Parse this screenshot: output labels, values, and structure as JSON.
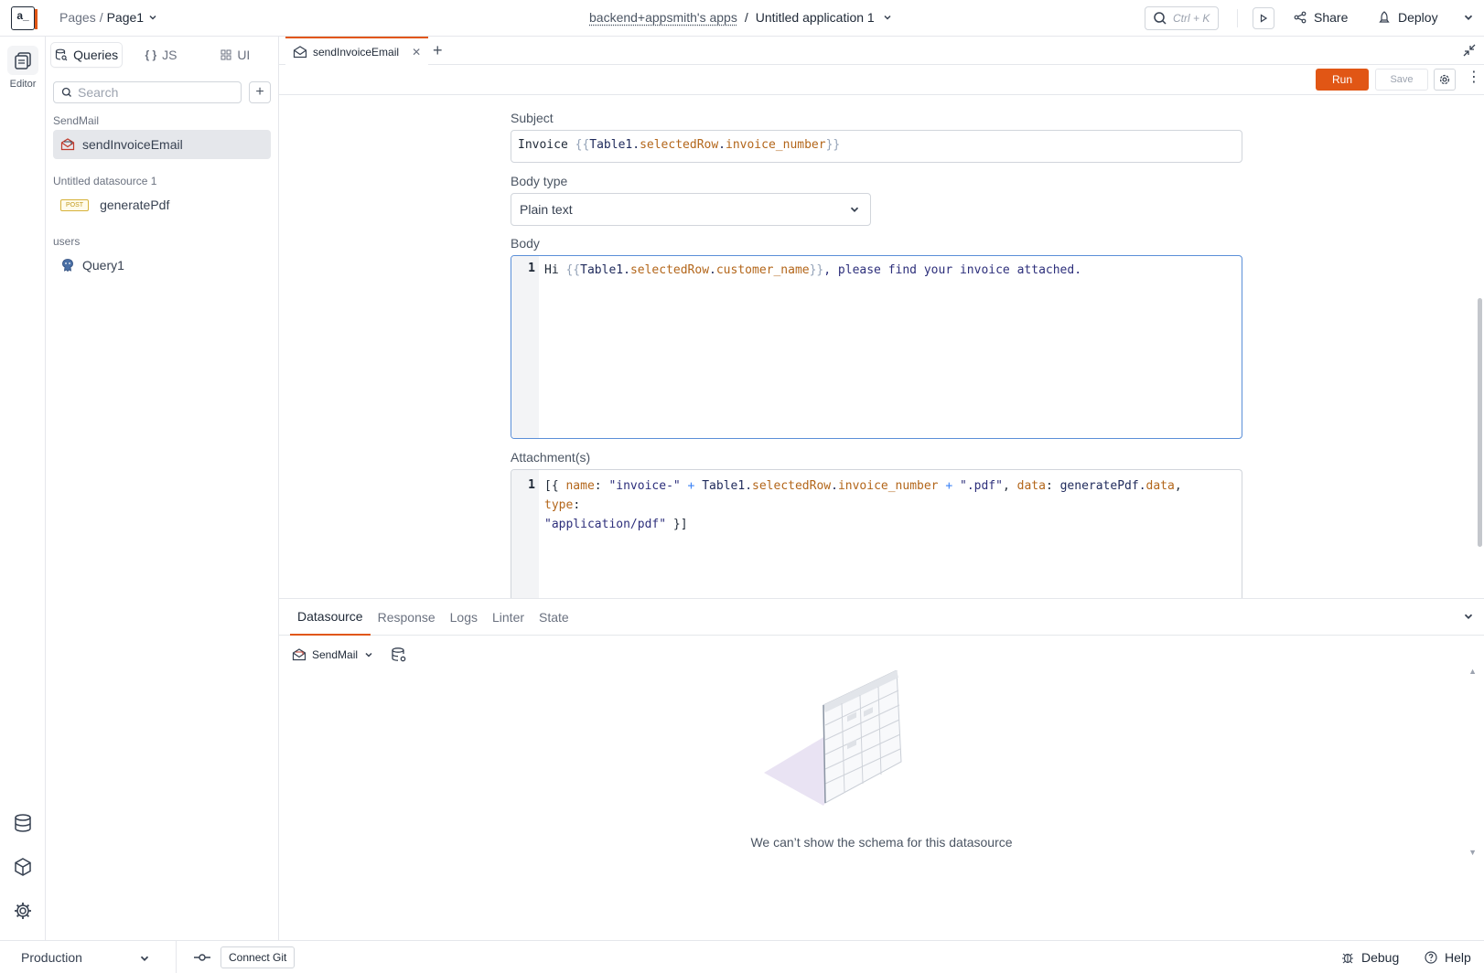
{
  "header": {
    "logo_text": "a_",
    "breadcrumb_root": "Pages",
    "breadcrumb_sep": "/",
    "page_name": "Page1",
    "workspace": "backend+appsmith's apps",
    "app_sep": "/",
    "app_name": "Untitled application 1",
    "search_shortcut": "Ctrl + K",
    "share_label": "Share",
    "deploy_label": "Deploy"
  },
  "rail": {
    "editor_label": "Editor",
    "icons": [
      "pages-icon",
      "datasource-icon",
      "packages-icon",
      "settings-icon"
    ]
  },
  "sidebar": {
    "tabs": [
      {
        "label": "Queries",
        "icon": "queries-icon",
        "active": true
      },
      {
        "label": "JS",
        "icon": "js-icon",
        "active": false
      },
      {
        "label": "UI",
        "icon": "ui-icon",
        "active": false
      }
    ],
    "search_placeholder": "Search",
    "groups": [
      {
        "name": "SendMail",
        "items": [
          {
            "label": "sendInvoiceEmail",
            "icon": "mail-icon",
            "active": true
          }
        ]
      },
      {
        "name": "Untitled datasource 1",
        "items": [
          {
            "label": "generatePdf",
            "badge": "POST",
            "active": false
          }
        ]
      },
      {
        "name": "users",
        "items": [
          {
            "label": "Query1",
            "icon": "postgres-icon",
            "active": false
          }
        ]
      }
    ]
  },
  "editor": {
    "tab_label": "sendInvoiceEmail",
    "run_label": "Run",
    "save_label": "Save",
    "subject": {
      "label": "Subject",
      "value_parts": [
        "Invoice ",
        "{{",
        "Table1",
        ".",
        "selectedRow",
        ".",
        "invoice_number",
        "}}"
      ]
    },
    "body_type": {
      "label": "Body type",
      "value": "Plain text"
    },
    "body": {
      "label": "Body",
      "line_no": "1",
      "parts": [
        "Hi ",
        "{{",
        "Table1",
        ".",
        "selectedRow",
        ".",
        "customer_name",
        "}}",
        ", please find your invoice attached."
      ]
    },
    "attachments": {
      "label": "Attachment(s)",
      "line_no": "1",
      "parts": [
        "[{ ",
        "name",
        ": ",
        "\"invoice-\"",
        " + ",
        "Table1",
        ".",
        "selectedRow",
        ".",
        "invoice_number",
        " + ",
        "\".pdf\"",
        ", ",
        "data",
        ": ",
        "generatePdf",
        ".",
        "data",
        ", ",
        "type",
        ":",
        "\n\"application/pdf\"",
        " }]"
      ]
    }
  },
  "bottom_panel": {
    "tabs": [
      "Datasource",
      "Response",
      "Logs",
      "Linter",
      "State"
    ],
    "active_tab": "Datasource",
    "datasource_name": "SendMail",
    "empty_message": "We can’t show the schema for this datasource"
  },
  "footer": {
    "environment": "Production",
    "connect_git": "Connect Git",
    "debug": "Debug",
    "help": "Help"
  },
  "colors": {
    "accent": "#e15615",
    "focus_border": "#5b8fd8"
  }
}
